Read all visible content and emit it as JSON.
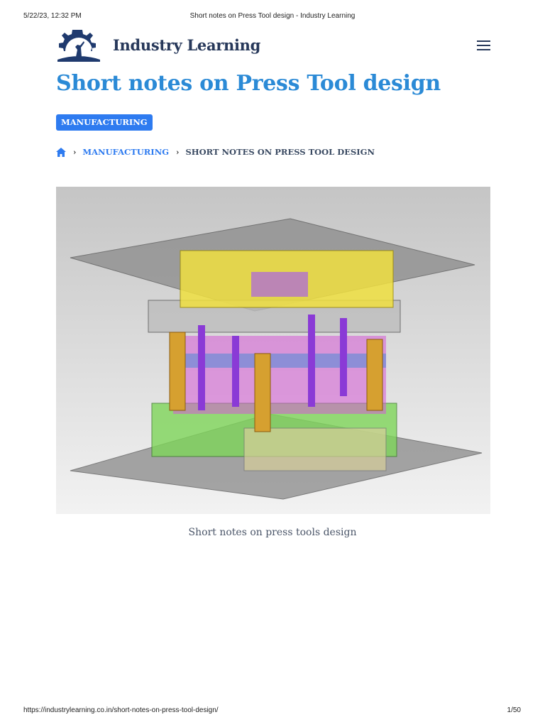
{
  "print_header": {
    "date": "5/22/23, 12:32 PM",
    "title": "Short notes on Press Tool design - Industry Learning"
  },
  "print_footer": {
    "url": "https://industrylearning.co.in/short-notes-on-press-tool-design/",
    "page": "1/50"
  },
  "site": {
    "brand": "Industry Learning",
    "logo_text": "Industry Learning"
  },
  "article": {
    "title": "Short notes on Press Tool design",
    "category": "MANUFACTURING",
    "breadcrumb": [
      "MANUFACTURING",
      "SHORT NOTES ON PRESS TOOL DESIGN"
    ],
    "figure_caption": "Short notes on press tools design"
  },
  "colors": {
    "accent": "#2b8ad6",
    "badge": "#2e7bf0",
    "brand": "#27385a"
  }
}
